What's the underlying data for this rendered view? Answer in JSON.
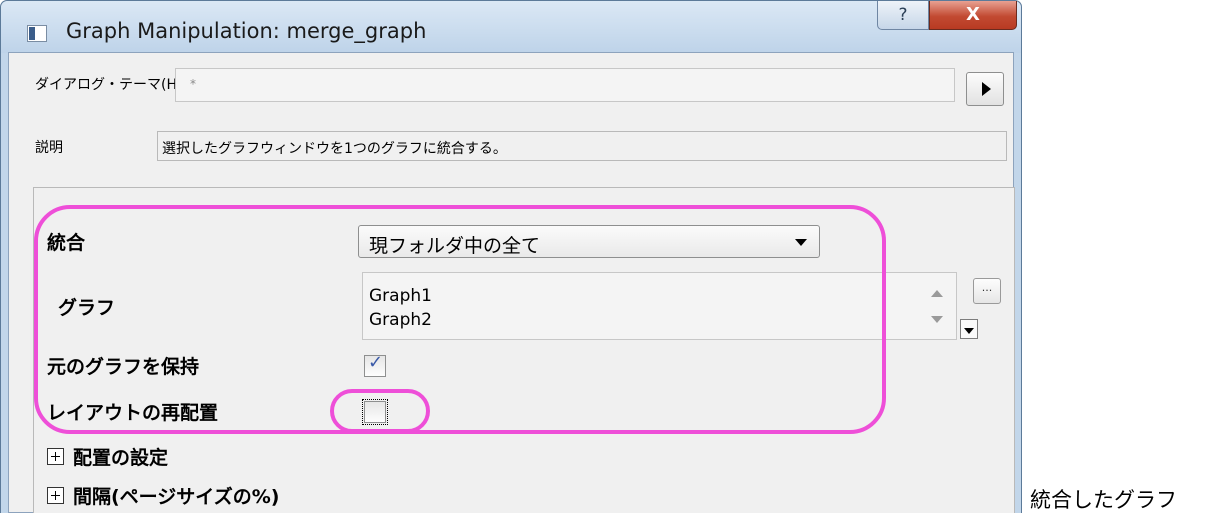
{
  "window": {
    "title": "Graph Manipulation: merge_graph",
    "help_label": "?",
    "close_label": "X"
  },
  "theme": {
    "label": "ダイアログ・テーマ(H)",
    "value": "*"
  },
  "description": {
    "label": "説明",
    "value": "選択したグラフウィンドウを1つのグラフに統合する。"
  },
  "form": {
    "merge_label": "統合",
    "merge_value": "現フォルダ中の全て",
    "graphs_label": "グラフ",
    "graphs": [
      "Graph1",
      "Graph2"
    ],
    "keep_label": "元のグラフを保持",
    "keep_checked": true,
    "rearrange_label": "レイアウトの再配置",
    "rearrange_checked": false,
    "arrange_label": "配置の設定",
    "spacing_label": "間隔(ページサイズの%)",
    "browse_label": "..."
  },
  "caption": "統合したグラフ",
  "colors": {
    "highlight": "#ee4fd8",
    "close_button": "#c24a32",
    "check_mark": "#3a5aa8"
  }
}
